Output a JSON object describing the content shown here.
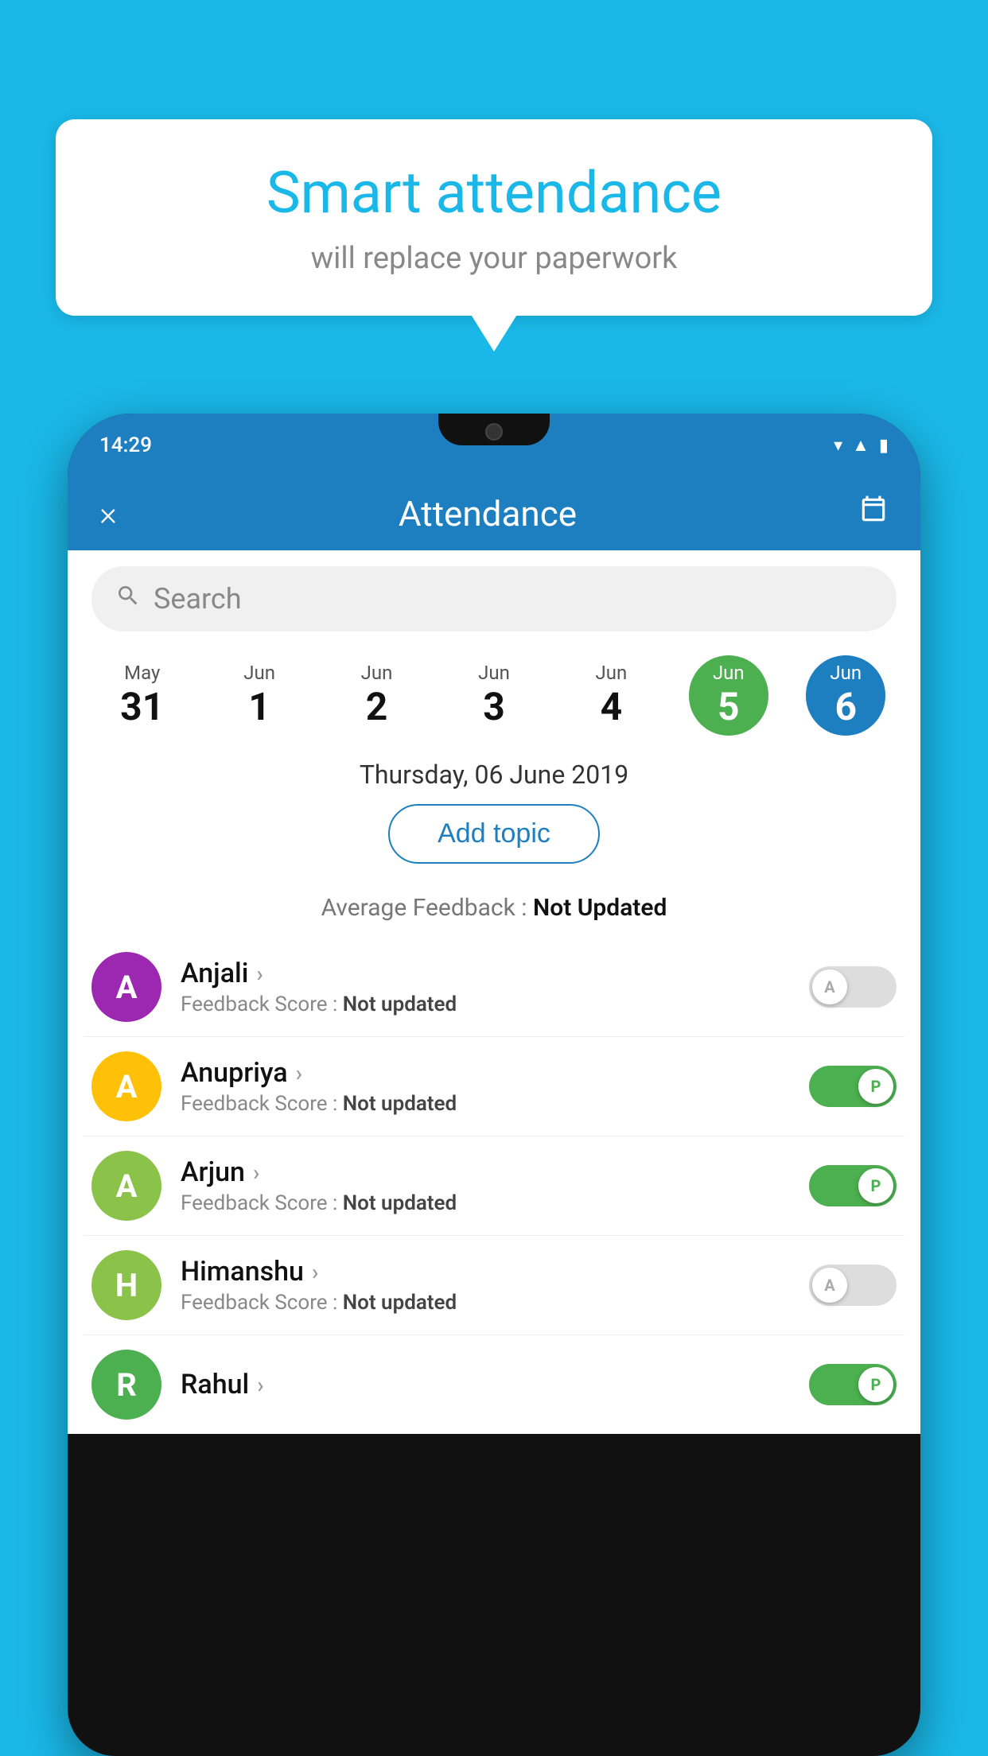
{
  "background_color": "#1ab8e8",
  "speech_bubble": {
    "title": "Smart attendance",
    "subtitle": "will replace your paperwork"
  },
  "status_bar": {
    "time": "14:29",
    "wifi_icon": "wifi",
    "signal_icon": "signal",
    "battery_icon": "battery"
  },
  "app_bar": {
    "title": "Attendance",
    "close_label": "×",
    "calendar_label": "📅"
  },
  "search": {
    "placeholder": "Search"
  },
  "dates": [
    {
      "month": "May",
      "day": "31",
      "selected": false
    },
    {
      "month": "Jun",
      "day": "1",
      "selected": false
    },
    {
      "month": "Jun",
      "day": "2",
      "selected": false
    },
    {
      "month": "Jun",
      "day": "3",
      "selected": false
    },
    {
      "month": "Jun",
      "day": "4",
      "selected": false
    },
    {
      "month": "Jun",
      "day": "5",
      "selected": "green"
    },
    {
      "month": "Jun",
      "day": "6",
      "selected": "blue"
    }
  ],
  "selected_date_label": "Thursday, 06 June 2019",
  "add_topic_label": "Add topic",
  "average_feedback": {
    "label": "Average Feedback : ",
    "value": "Not Updated"
  },
  "students": [
    {
      "name": "Anjali",
      "avatar_letter": "A",
      "avatar_color": "#9c27b0",
      "feedback_label": "Feedback Score : ",
      "feedback_value": "Not updated",
      "toggle": "off",
      "toggle_label": "A"
    },
    {
      "name": "Anupriya",
      "avatar_letter": "A",
      "avatar_color": "#ffc107",
      "feedback_label": "Feedback Score : ",
      "feedback_value": "Not updated",
      "toggle": "on",
      "toggle_label": "P"
    },
    {
      "name": "Arjun",
      "avatar_letter": "A",
      "avatar_color": "#8bc34a",
      "feedback_label": "Feedback Score : ",
      "feedback_value": "Not updated",
      "toggle": "on",
      "toggle_label": "P"
    },
    {
      "name": "Himanshu",
      "avatar_letter": "H",
      "avatar_color": "#8bc34a",
      "feedback_label": "Feedback Score : ",
      "feedback_value": "Not updated",
      "toggle": "off",
      "toggle_label": "A"
    }
  ]
}
